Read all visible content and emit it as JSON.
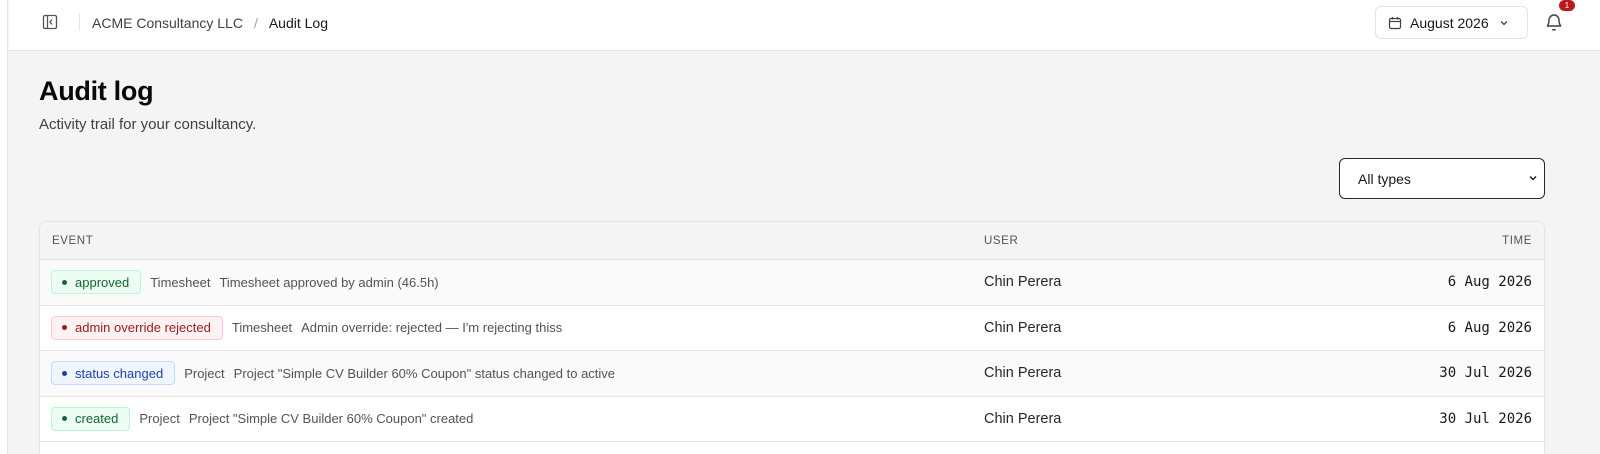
{
  "breadcrumb": {
    "parent": "ACME Consultancy LLC",
    "separator": "/",
    "current": "Audit Log"
  },
  "month_picker": {
    "value": "August 2026",
    "icon": "calendar-icon"
  },
  "notifications": {
    "count": "1",
    "icon": "bell-icon"
  },
  "page": {
    "title": "Audit log",
    "subtitle": "Activity trail for your consultancy."
  },
  "filter": {
    "selected": "All types"
  },
  "table": {
    "headers": {
      "event": "EVENT",
      "user": "USER",
      "time": "TIME"
    },
    "rows": [
      {
        "badge": "approved",
        "badge_color": "#166534",
        "entity": "Timesheet",
        "description": "Timesheet approved by admin (46.5h)",
        "user": "Chin Perera",
        "time": "6 Aug 2026"
      },
      {
        "badge": "admin override rejected",
        "badge_color": "#991b1b",
        "entity": "Timesheet",
        "description": "Admin override: rejected — I'm rejecting thiss",
        "user": "Chin Perera",
        "time": "6 Aug 2026"
      },
      {
        "badge": "status changed",
        "badge_color": "#1e40af",
        "entity": "Project",
        "description": "Project \"Simple CV Builder 60% Coupon\" status changed to active",
        "user": "Chin Perera",
        "time": "30 Jul 2026"
      },
      {
        "badge": "created",
        "badge_color": "#166534",
        "entity": "Project",
        "description": "Project \"Simple CV Builder 60% Coupon\" created",
        "user": "Chin Perera",
        "time": "30 Jul 2026"
      }
    ]
  }
}
